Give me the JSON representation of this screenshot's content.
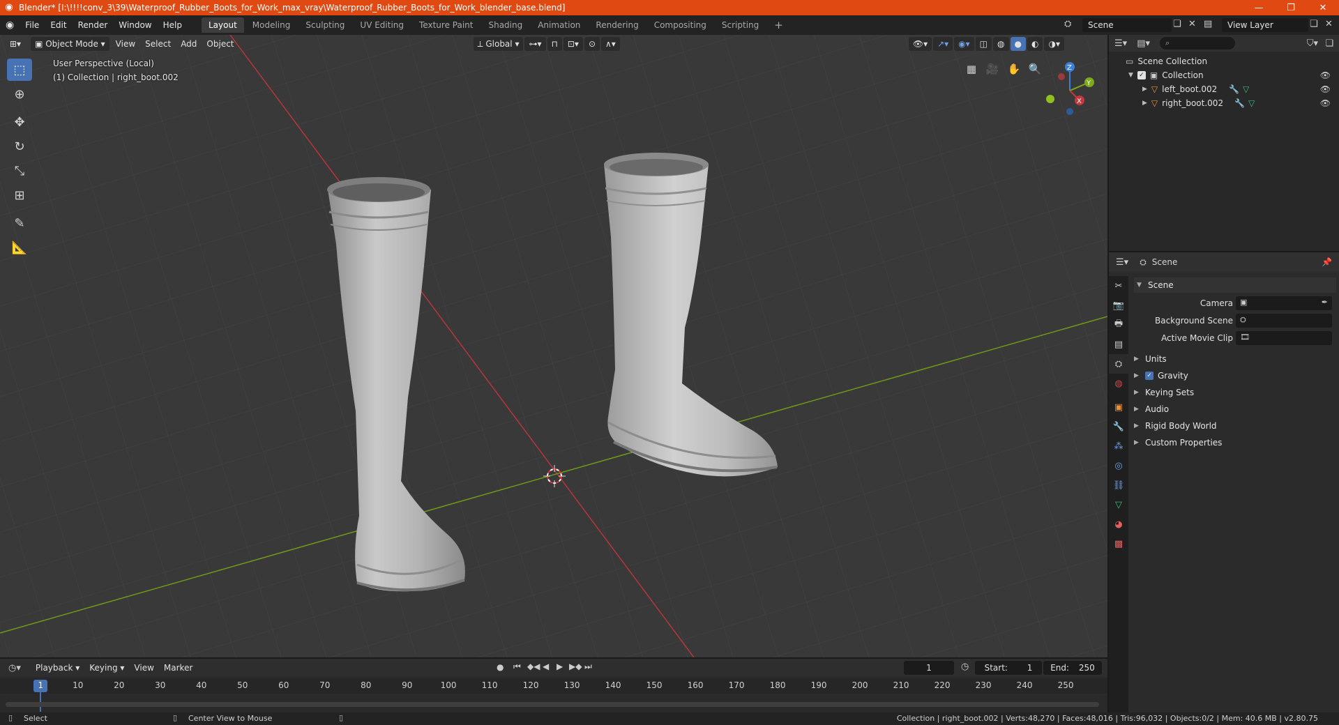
{
  "window": {
    "title": "Blender* [I:\\!!!!conv_3\\39\\Waterproof_Rubber_Boots_for_Work_max_vray\\Waterproof_Rubber_Boots_for_Work_blender_base.blend]",
    "minimize": "—",
    "maximize": "❐",
    "close": "✕"
  },
  "menu": [
    "File",
    "Edit",
    "Render",
    "Window",
    "Help"
  ],
  "workspaces": [
    "Layout",
    "Modeling",
    "Sculpting",
    "UV Editing",
    "Texture Paint",
    "Shading",
    "Animation",
    "Rendering",
    "Compositing",
    "Scripting"
  ],
  "active_workspace": "Layout",
  "add_workspace": "+",
  "scene_name": "Scene",
  "view_layer": "View Layer",
  "viewport": {
    "mode": "Object Mode",
    "menus": [
      "View",
      "Select",
      "Add",
      "Object"
    ],
    "orientation": "Global",
    "info_line1": "User Perspective (Local)",
    "info_line2": "(1) Collection | right_boot.002",
    "gizmo": {
      "x": "X",
      "y": "Y",
      "z": "Z"
    }
  },
  "outliner": {
    "root": "Scene Collection",
    "collection": "Collection",
    "objects": [
      "left_boot.002",
      "right_boot.002"
    ]
  },
  "properties": {
    "header": "Scene",
    "panel": "Scene",
    "camera_label": "Camera",
    "background_scene_label": "Background Scene",
    "active_movie_clip_label": "Active Movie Clip",
    "subpanels": [
      "Units",
      "Gravity",
      "Keying Sets",
      "Audio",
      "Rigid Body World",
      "Custom Properties"
    ],
    "gravity_checked": true
  },
  "timeline": {
    "menus": [
      "Playback",
      "Keying",
      "View",
      "Marker"
    ],
    "current_frame": "1",
    "start_label": "Start:",
    "start": "1",
    "end_label": "End:",
    "end": "250",
    "ticks": [
      "1",
      "10",
      "20",
      "30",
      "40",
      "50",
      "60",
      "70",
      "80",
      "90",
      "100",
      "110",
      "120",
      "130",
      "140",
      "150",
      "160",
      "170",
      "180",
      "190",
      "200",
      "210",
      "220",
      "230",
      "240",
      "250"
    ]
  },
  "status": {
    "left_action": "Select",
    "mid_action": "Center View to Mouse",
    "stats": "Collection | right_boot.002 | Verts:48,270 | Faces:48,016 | Tris:96,032 | Objects:0/2 | Mem: 40.6 MB | v2.80.75"
  },
  "colors": {
    "title_bar": "#e04a12",
    "accent": "#4772b3",
    "x_axis": "#c0393f",
    "y_axis": "#7eaa1d",
    "z_axis": "#3b7fd6"
  }
}
